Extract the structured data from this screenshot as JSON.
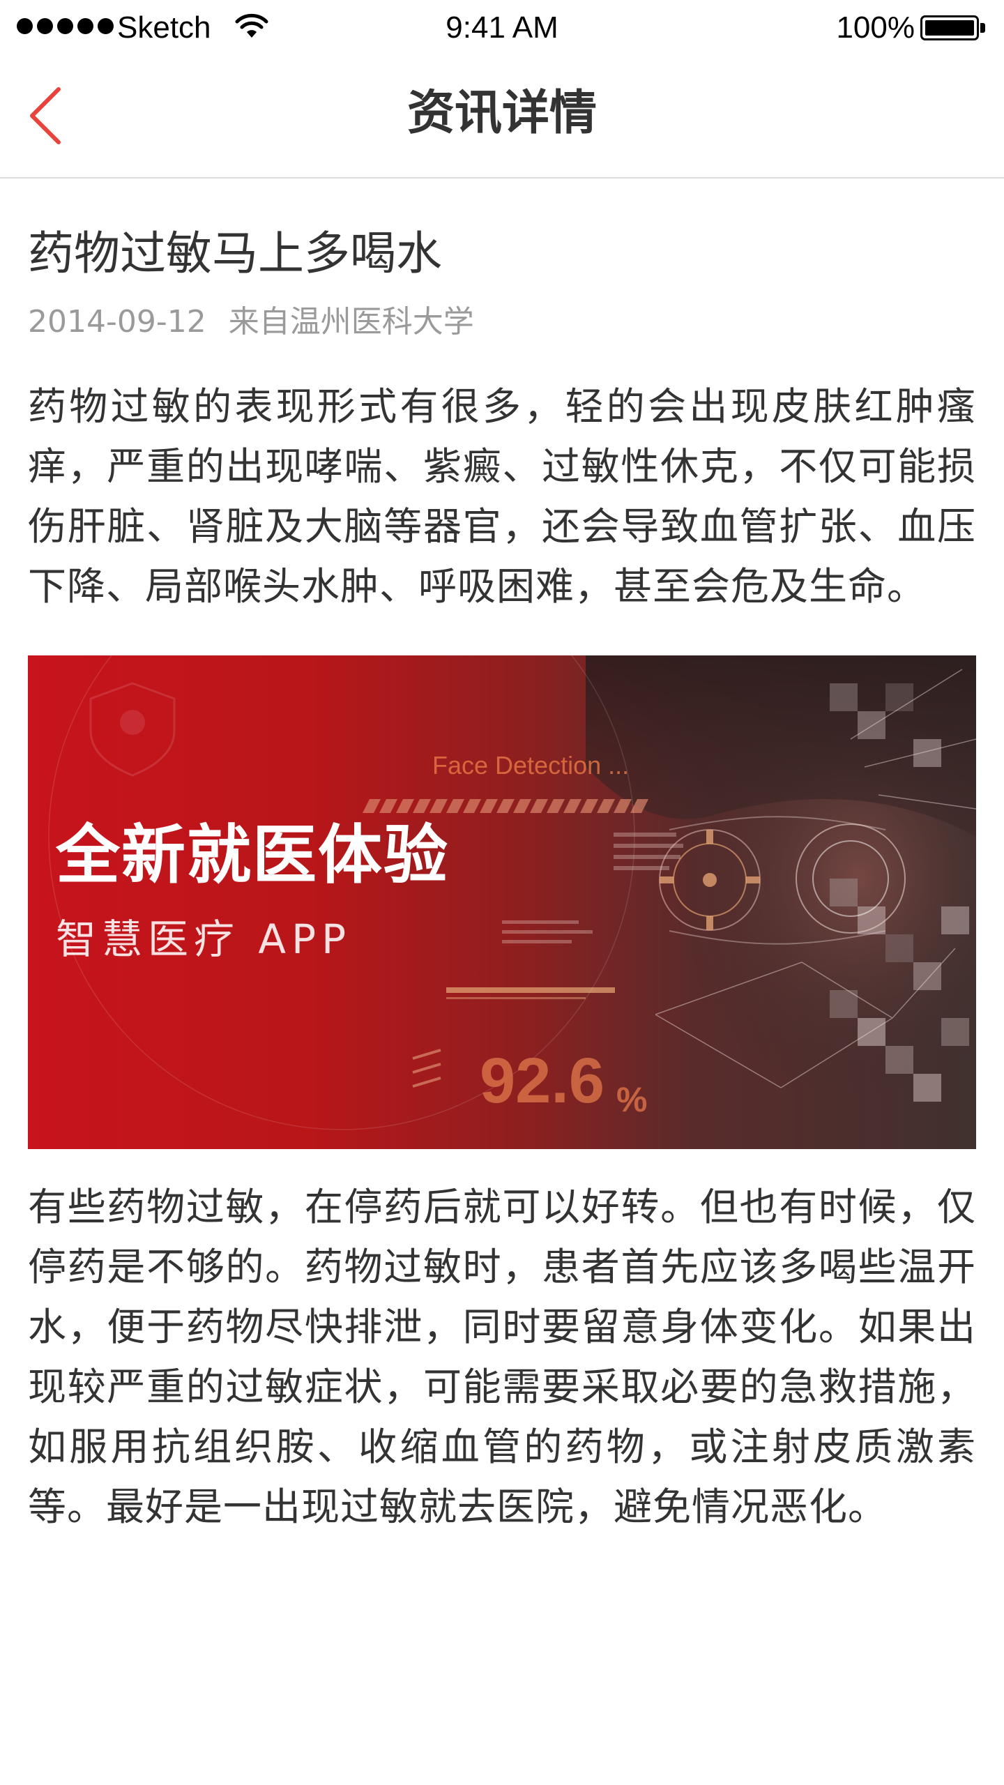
{
  "status_bar": {
    "carrier": "Sketch",
    "time": "9:41 AM",
    "battery": "100%"
  },
  "nav": {
    "title": "资讯详情"
  },
  "article": {
    "title": "药物过敏马上多喝水",
    "date": "2014-09-12",
    "source": "来自温州医科大学",
    "paragraph_1": "药物过敏的表现形式有很多，轻的会出现皮肤红肿瘙痒，严重的出现哮喘、紫癜、过敏性休克，不仅可能损伤肝脏、肾脏及大脑等器官，还会导致血管扩张、血压下降、局部喉头水肿、呼吸困难，甚至会危及生命。",
    "paragraph_2": "有些药物过敏，在停药后就可以好转。但也有时候，仅停药是不够的。药物过敏时，患者首先应该多喝些温开水，便于药物尽快排泄，同时要留意身体变化。如果出现较严重的过敏症状，可能需要采取必要的急救措施，如服用抗组织胺、收缩血管的药物，或注射皮质激素等。最好是一出现过敏就去医院，避免情况恶化。"
  },
  "banner": {
    "headline": "全新就医体验",
    "subtitle": "智慧医疗 APP",
    "face_label": "Face Detection ...",
    "percent": "92.6",
    "percent_sign": "%"
  },
  "colors": {
    "accent": "#e8433c",
    "banner_red": "#c8141c"
  },
  "icons": {
    "back": "chevron-left-icon",
    "wifi": "wifi-icon",
    "battery": "battery-icon"
  }
}
